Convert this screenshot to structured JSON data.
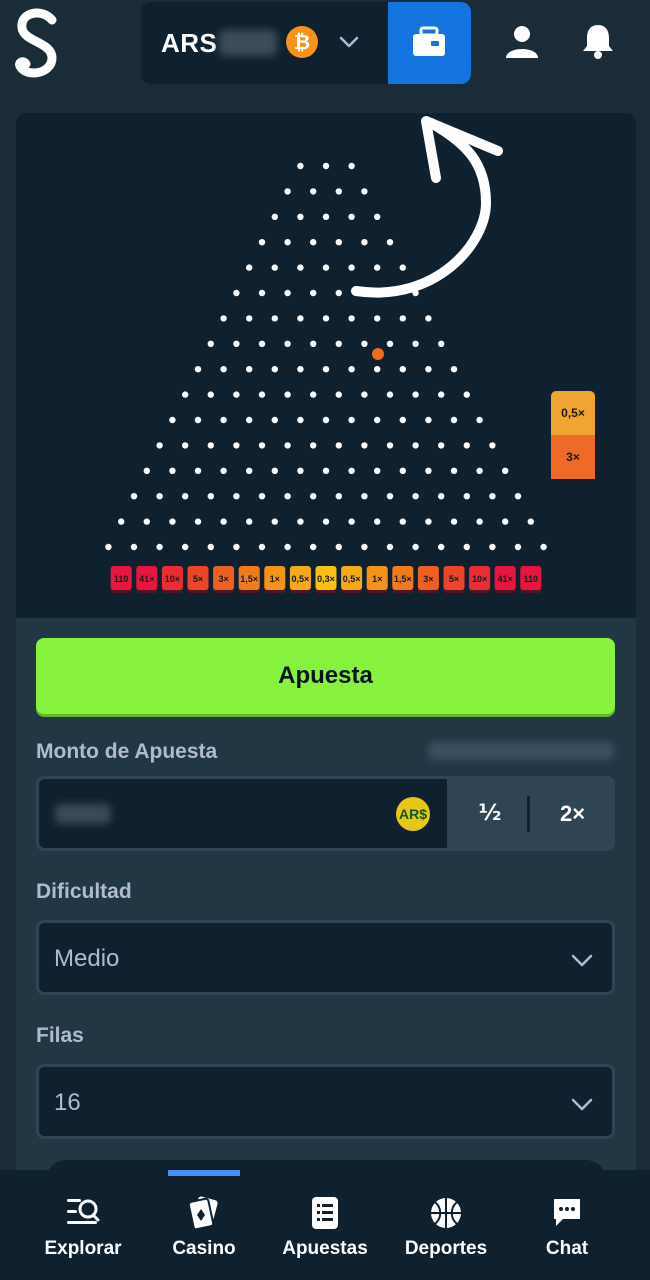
{
  "header": {
    "currency": "ARS",
    "btc_symbol": "₿"
  },
  "board": {
    "multipliers": [
      "110",
      "41×",
      "10×",
      "5×",
      "3×",
      "1,5×",
      "1×",
      "0,5×",
      "0,3×",
      "0,5×",
      "1×",
      "1,5×",
      "3×",
      "5×",
      "10×",
      "41×",
      "110"
    ],
    "bucket_colors": [
      "#e8153f",
      "#e8153f",
      "#ea2c35",
      "#ec462a",
      "#ee5f22",
      "#f07a1e",
      "#f2941a",
      "#f4aa16",
      "#f6c112",
      "#f4aa16",
      "#f2941a",
      "#f07a1e",
      "#ee5f22",
      "#ec462a",
      "#ea2c35",
      "#e8153f",
      "#e8153f"
    ],
    "history": [
      "0,5×",
      "3×"
    ]
  },
  "controls": {
    "bet_label": "Apuesta",
    "amount_label": "Monto de Apuesta",
    "amount_currency_badge": "AR$",
    "half_label": "½",
    "double_label": "2×",
    "difficulty_label": "Dificultad",
    "difficulty_value": "Medio",
    "rows_label": "Filas",
    "rows_value": "16"
  },
  "nav": {
    "items": [
      {
        "label": "Explorar"
      },
      {
        "label": "Casino"
      },
      {
        "label": "Apuestas"
      },
      {
        "label": "Deportes"
      },
      {
        "label": "Chat"
      }
    ]
  },
  "colors": {
    "accent_green": "#87f33f",
    "wallet_blue": "#1475e1",
    "ball_orange": "#f26a1b"
  }
}
